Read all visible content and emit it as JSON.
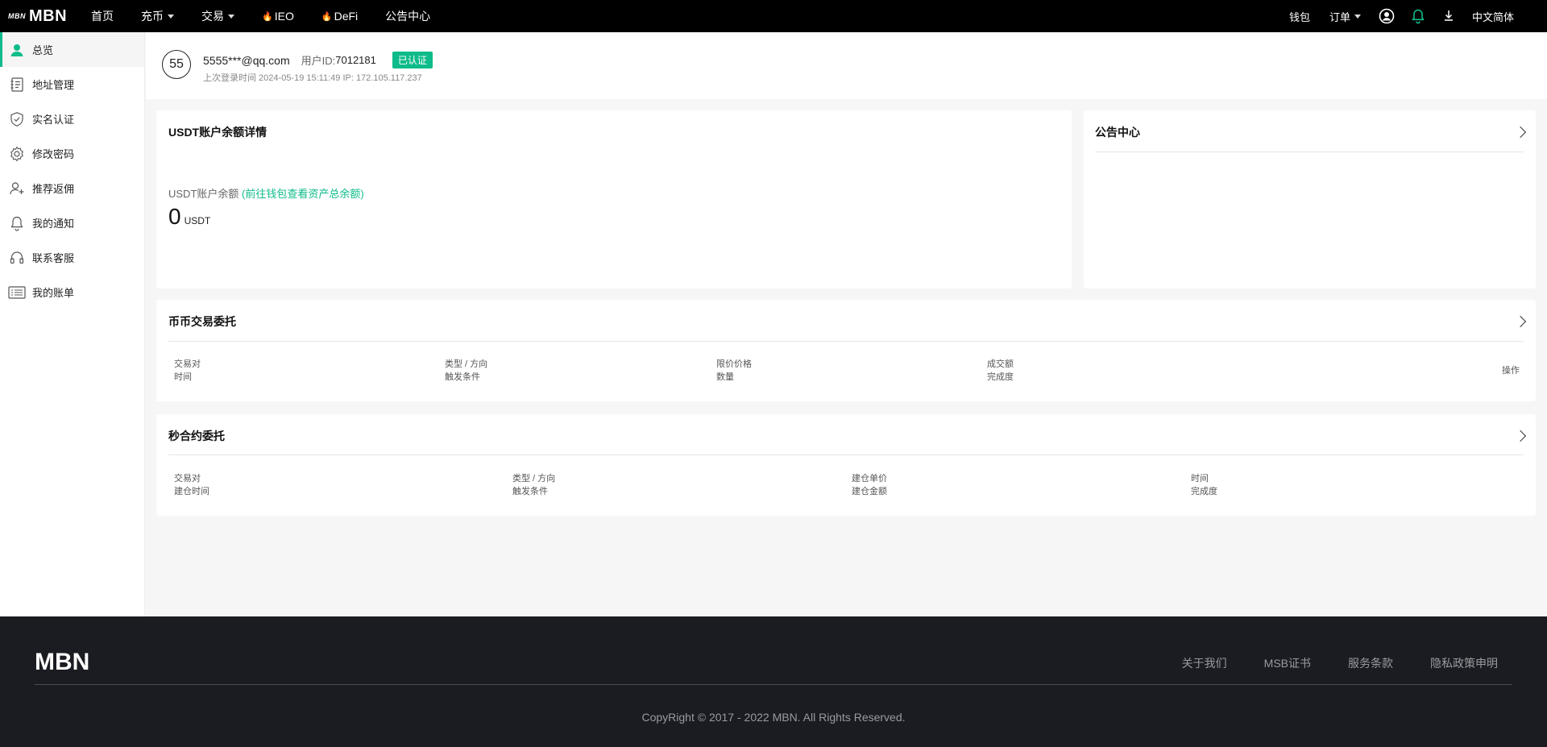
{
  "brand": {
    "logo_mark": "MBN",
    "logo_text": "MBN"
  },
  "topnav": {
    "items": [
      {
        "label": "首页",
        "dropdown": false
      },
      {
        "label": "充币",
        "dropdown": true
      },
      {
        "label": "交易",
        "dropdown": true
      },
      {
        "label": "IEO",
        "hot": true
      },
      {
        "label": "DeFi",
        "hot": true
      },
      {
        "label": "公告中心"
      }
    ],
    "right": {
      "wallet": "钱包",
      "orders": "订单",
      "language": "中文简体"
    }
  },
  "sidebar": {
    "items": [
      {
        "label": "总览",
        "icon": "user-icon",
        "active": true
      },
      {
        "label": "地址管理",
        "icon": "address-book-icon"
      },
      {
        "label": "实名认证",
        "icon": "shield-check-icon"
      },
      {
        "label": "修改密码",
        "icon": "gear-icon"
      },
      {
        "label": "推荐返佣",
        "icon": "user-plus-icon"
      },
      {
        "label": "我的通知",
        "icon": "bell-icon"
      },
      {
        "label": "联系客服",
        "icon": "headset-icon"
      },
      {
        "label": "我的账单",
        "icon": "list-icon"
      }
    ]
  },
  "user": {
    "avatar_text": "55",
    "email": "5555***@qq.com",
    "uid_label": "用户ID:",
    "uid": "7012181",
    "verified_badge": "已认证",
    "last_login": "上次登录时间 2024-05-19 15:11:49   IP: 172.105.117.237"
  },
  "balance_card": {
    "title": "USDT账户余额详情",
    "label": "USDT账户余额",
    "link": "(前往钱包查看资产总余额)",
    "amount": "0",
    "unit": "USDT"
  },
  "announcement_card": {
    "title": "公告中心"
  },
  "spot_orders": {
    "title": "币币交易委托",
    "columns": [
      {
        "top": "交易对",
        "bottom": "时间"
      },
      {
        "top": "类型 / 方向",
        "bottom": "触发条件"
      },
      {
        "top": "限价价格",
        "bottom": "数量"
      },
      {
        "top": "成交额",
        "bottom": "完成度"
      }
    ],
    "action": "操作"
  },
  "second_orders": {
    "title": "秒合约委托",
    "columns": [
      {
        "top": "交易对",
        "bottom": "建仓时间"
      },
      {
        "top": "类型 / 方向",
        "bottom": "触发条件"
      },
      {
        "top": "建仓单价",
        "bottom": "建仓金额"
      },
      {
        "top": "时间",
        "bottom": "完成度"
      }
    ]
  },
  "footer": {
    "logo": "MBN",
    "links": [
      "关于我们",
      "MSB证书",
      "服务条款",
      "隐私政策申明"
    ],
    "copyright": "CopyRight © 2017 - 2022 MBN. All Rights Reserved."
  },
  "colors": {
    "accent": "#0ebb8a",
    "topbar": "#000000",
    "footer": "#1b1c21"
  }
}
